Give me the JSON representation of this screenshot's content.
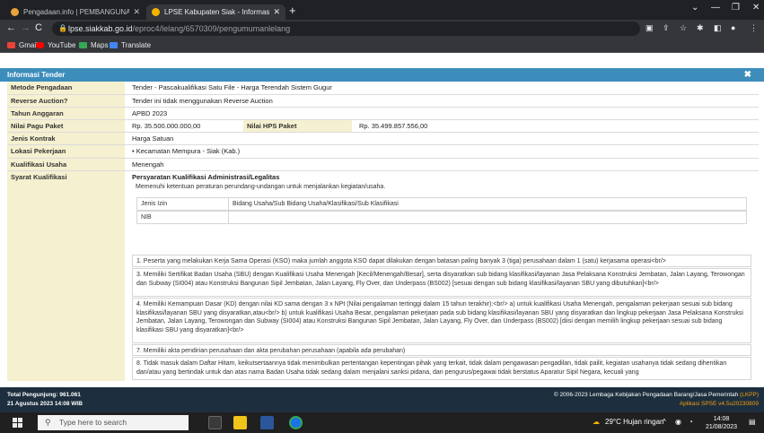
{
  "browser": {
    "tabs": [
      {
        "title": "Pengadaan.info | PEMBANGUNA",
        "active": false
      },
      {
        "title": "LPSE Kabupaten Siak - Informas",
        "active": true
      }
    ],
    "url_host": "lpse.siakkab.go.id",
    "url_path": "/eproc4/lelang/6570309/pengumumanlelang",
    "bookmarks": [
      "Gmail",
      "YouTube",
      "Maps",
      "Translate"
    ]
  },
  "modal": {
    "title": "Informasi Tender"
  },
  "details": {
    "metode_label": "Metode Pengadaan",
    "metode_value": "Tender - Pascakualifikasi Satu File - Harga Terendah Sistem Gugur",
    "reverse_label": "Reverse Auction?",
    "reverse_value": "Tender ini tidak menggunakan Reverse Auction",
    "tahun_label": "Tahun Anggaran",
    "tahun_value": "APBD 2023",
    "pagu_label": "Nilai Pagu Paket",
    "pagu_value": "Rp. 35.500.000.000,00",
    "hps_label": "Nilai HPS Paket",
    "hps_value": "Rp. 35.499.857.556,00",
    "kontrak_label": "Jenis Kontrak",
    "kontrak_value": "Harga Satuan",
    "lokasi_label": "Lokasi Pekerjaan",
    "lokasi_value": "• Kecamatan Mempura - Siak (Kab.)",
    "kualifikasi_label": "Kualifikasi Usaha",
    "kualifikasi_value": "Menengah",
    "syarat_label": "Syarat Kualifikasi",
    "syarat_heading": "Persyaratan Kualifikasi Administrasi/Legalitas",
    "syarat_intro": "Memenuhi ketentuan peraturan perundang-undangan untuk menjalankan kegiatan/usaha.",
    "izin_header": [
      "Jenis Izin",
      "Bidang Usaha/Sub Bidang Usaha/Klasifikasi/Sub Klasifikasi"
    ],
    "izin_row": "NIB",
    "items": [
      "1. Peserta yang melakukan Kerja Sama Operasi (KSO) maka jumlah anggota KSO dapat dilakukan dengan batasan paling banyak 3 (tiga) perusahaan dalam 1 (satu) kerjasama operasi<br/>",
      "3. Memiliki Sertifikat Badan Usaha (SBU) dengan Kualifikasi Usaha Menengah [Kecil/Menengah/Besar], serta disyaratkan sub bidang klasifikasi/layanan Jasa Pelaksana Konstruksi Jembatan, Jalan Layang, Terowongan dan Subway (SI004) atau Konstruksi Bangunan Sipil Jembatan, Jalan Layang, Fly Over, dan Underpass (BS002) [sesuai dengan sub bidang klasifikasi/layanan SBU yang dibutuhkan]<br/>",
      "4. Memiliki Kemampuan Dasar (KD) dengan nilai KD sama dengan 3 x NPt (Nilai pengalaman tertinggi dalam 15 tahun terakhir):<br/> a) untuk kualifikasi Usaha Menengah, pengalaman pekerjaan sesuai sub bidang klasifikasi/layanan SBU yang disyaratkan,atau<br/> b) untuk kualifikasi Usaha Besar, pengalaman pekerjaan pada sub bidang klasifikasi/layanan SBU yang disyaratkan dan lingkup pekerjaan Jasa Pelaksana Konstruksi Jembatan, Jalan Layang, Terowongan dan Subway (SI004) atau Konstruksi Bangunan Sipil Jembatan, Jalan Layang, Fly Over, dan Underpass (BS002) [diisi dengan memilih lingkup pekerjaan sesuai sub bidang klasifikasi SBU yang disyaratkan]<br/>",
      "7. Memiliki akta pendirian perusahaan dan akta perubahan perusahaan (apabila ada perubahan)",
      "8. Tidak masuk dalam Daftar Hitam, keikutsertaannya tidak menimbulkan pertentangan kepentingan pihak yang terkait, tidak dalam pengawasan pengadilan, tidak pailit, kegiatan usahanya tidak sedang dihentikan dan/atau yang bertindak untuk dan atas nama Badan Usaha tidak sedang dalam menjalani sanksi pidana, dan pengurus/pegawai tidak berstatus Aparatur Sipil Negara, kecuali yang"
    ]
  },
  "footer": {
    "visitors": "Total Pengunjung: 961.061",
    "date": "21 Agustus 2023 14:08 WIB",
    "copyright": "© 2006-2023 Lembaga Kebijakan Pengadaan Barang/Jasa Pemerintah",
    "lkpp": "(LKPP)",
    "version": "Aplikasi SPSE v4.5u20230809"
  },
  "taskbar": {
    "search_placeholder": "Type here to search",
    "weather": "29°C Hujan ringan",
    "time": "14:08",
    "date": "21/08/2023"
  }
}
